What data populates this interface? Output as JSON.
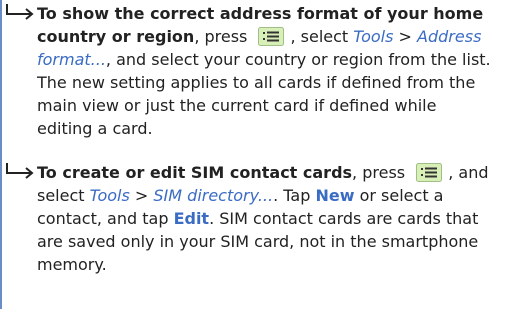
{
  "para1": {
    "bold_lead_1": "To show the correct address format of your home",
    "bold_lead_2": "country or region",
    "t_press": ", press",
    "t_select": ", select",
    "tools": "Tools",
    "gt": ">",
    "address": "Address",
    "format": "format...",
    "t_after_format": ", and select your country or region from the list.",
    "line4": "The new setting applies to all cards if defined from the",
    "line5": "main view or just the current card if defined while",
    "line6": "editing a card."
  },
  "para2": {
    "bold_lead": "To create or edit SIM contact cards",
    "t_press": ", press",
    "t_and": ", and",
    "t_select": "select",
    "tools": "Tools",
    "gt": ">",
    "sim_directory": "SIM directory...",
    "t_tap": ". Tap",
    "new_label": "New",
    "t_or_select": "or select a",
    "t_contact": "contact, and tap",
    "edit_label": "Edit",
    "t_after_edit": ". SIM contact cards are cards that",
    "line4": "are saved only in your SIM card, not in the smartphone",
    "line5": "memory."
  },
  "colors": {
    "link": "#3b6cc4",
    "text": "#222222",
    "margin_bar": "#6a8cc7",
    "key_bg": "#d9efb8"
  },
  "icons": {
    "arrow": "arrow-right-hook-icon",
    "menu_key": "menu-key-icon"
  }
}
